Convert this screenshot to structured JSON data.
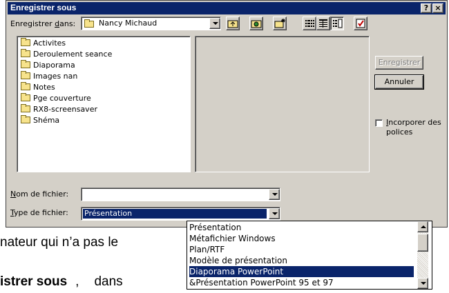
{
  "dialog": {
    "title": "Enregistrer sous",
    "help_btn": "?",
    "close_btn": "×",
    "save_in": {
      "label_pre": "Enregistrer ",
      "label_ul": "d",
      "label_post": "ans:",
      "value": "Nancy Michaud"
    },
    "files": [
      "Activites",
      "Deroulement seance",
      "Diaporama",
      "Images nan",
      "Notes",
      "Pge couverture",
      "RX8-screensaver",
      "Shéma"
    ],
    "filename": {
      "label_ul": "N",
      "label_rest": "om de fichier:",
      "value": ""
    },
    "filetype": {
      "label_ul": "T",
      "label_rest": "ype de fichier:",
      "value": "Présentation"
    },
    "buttons": {
      "save": "Enregistrer",
      "cancel": "Annuler"
    },
    "embed_fonts": {
      "label_ul": "I",
      "label_line1_rest": "ncorporer des",
      "label_line2": "polices",
      "checked": false
    }
  },
  "filetype_options": [
    "Présentation",
    "Métafichier Windows",
    "Plan/RTF",
    "Modèle de présentation",
    "Diaporama PowerPoint",
    "&Présentation PowerPoint 95 et 97"
  ],
  "filetype_selected_index": 4,
  "background_text": {
    "line1": "nateur qui n’a pas le",
    "line2_bold": "istrer sous",
    "line2_rest": "dans"
  },
  "colors": {
    "titlebar": "#0a246a",
    "selection": "#0a246a",
    "face": "#d4d0c8"
  }
}
